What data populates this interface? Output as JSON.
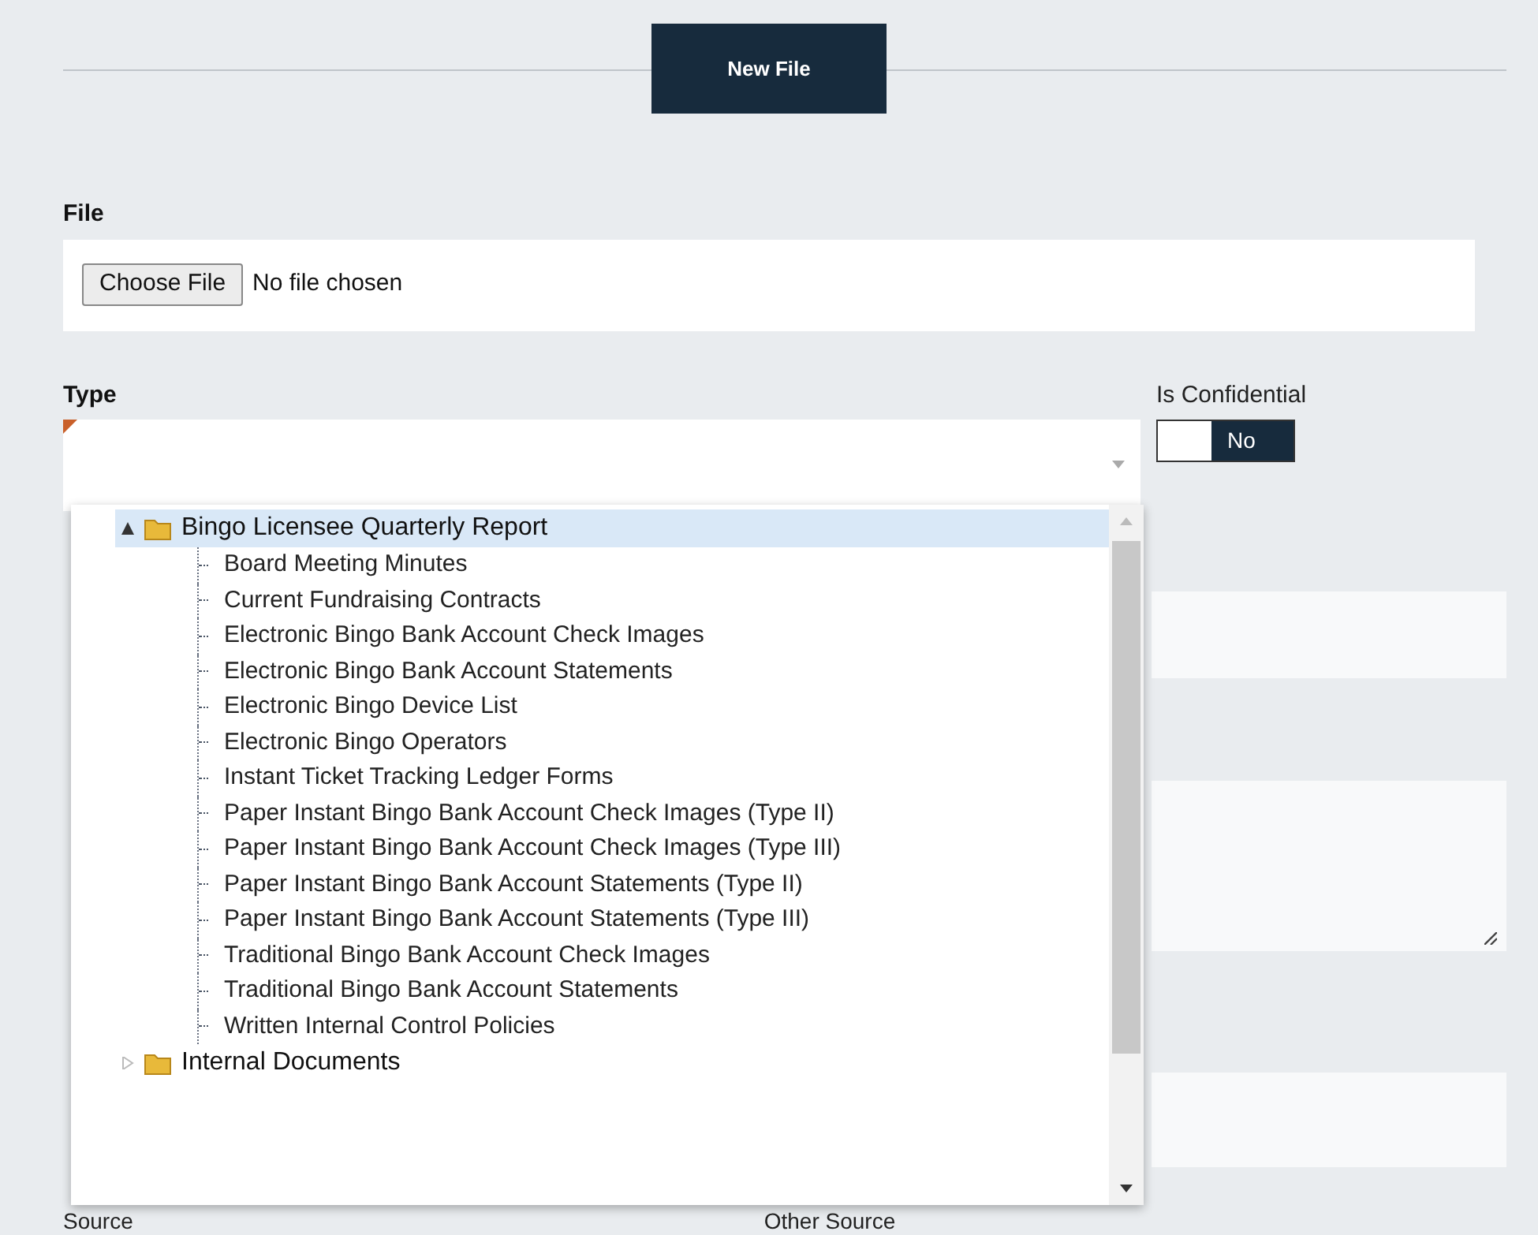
{
  "header": {
    "button": "New File"
  },
  "file": {
    "label": "File",
    "button": "Choose File",
    "status": "No file chosen"
  },
  "type": {
    "label": "Type",
    "required": true
  },
  "confidential": {
    "label": "Is Confidential",
    "toggle": "No",
    "on": false
  },
  "type_tree": [
    {
      "label": "Bingo Licensee Quarterly Report",
      "expanded": true,
      "selected": true,
      "children": [
        {
          "label": "Board Meeting Minutes",
          "selected": false
        },
        {
          "label": "Current Fundraising Contracts",
          "selected": false
        },
        {
          "label": "Electronic Bingo Bank Account Check Images",
          "selected": false
        },
        {
          "label": "Electronic Bingo Bank Account Statements",
          "selected": false
        },
        {
          "label": "Electronic Bingo Device List",
          "selected": false
        },
        {
          "label": "Electronic Bingo Operators",
          "selected": false
        },
        {
          "label": "Instant Ticket Tracking Ledger Forms",
          "selected": false
        },
        {
          "label": "Paper Instant Bingo Bank Account Check Images (Type II)",
          "selected": false
        },
        {
          "label": "Paper Instant Bingo Bank Account Check Images (Type III)",
          "selected": false
        },
        {
          "label": "Paper Instant Bingo Bank Account Statements (Type II)",
          "selected": false
        },
        {
          "label": "Paper Instant Bingo Bank Account Statements (Type III)",
          "selected": false
        },
        {
          "label": "Traditional Bingo Bank Account Check Images",
          "selected": false
        },
        {
          "label": "Traditional Bingo Bank Account Statements",
          "selected": false
        },
        {
          "label": "Written Internal Control Policies",
          "selected": false
        }
      ]
    },
    {
      "label": "Internal Documents",
      "expanded": false,
      "selected": false
    }
  ],
  "bottom_labels": [
    "Source",
    "Other Source"
  ]
}
